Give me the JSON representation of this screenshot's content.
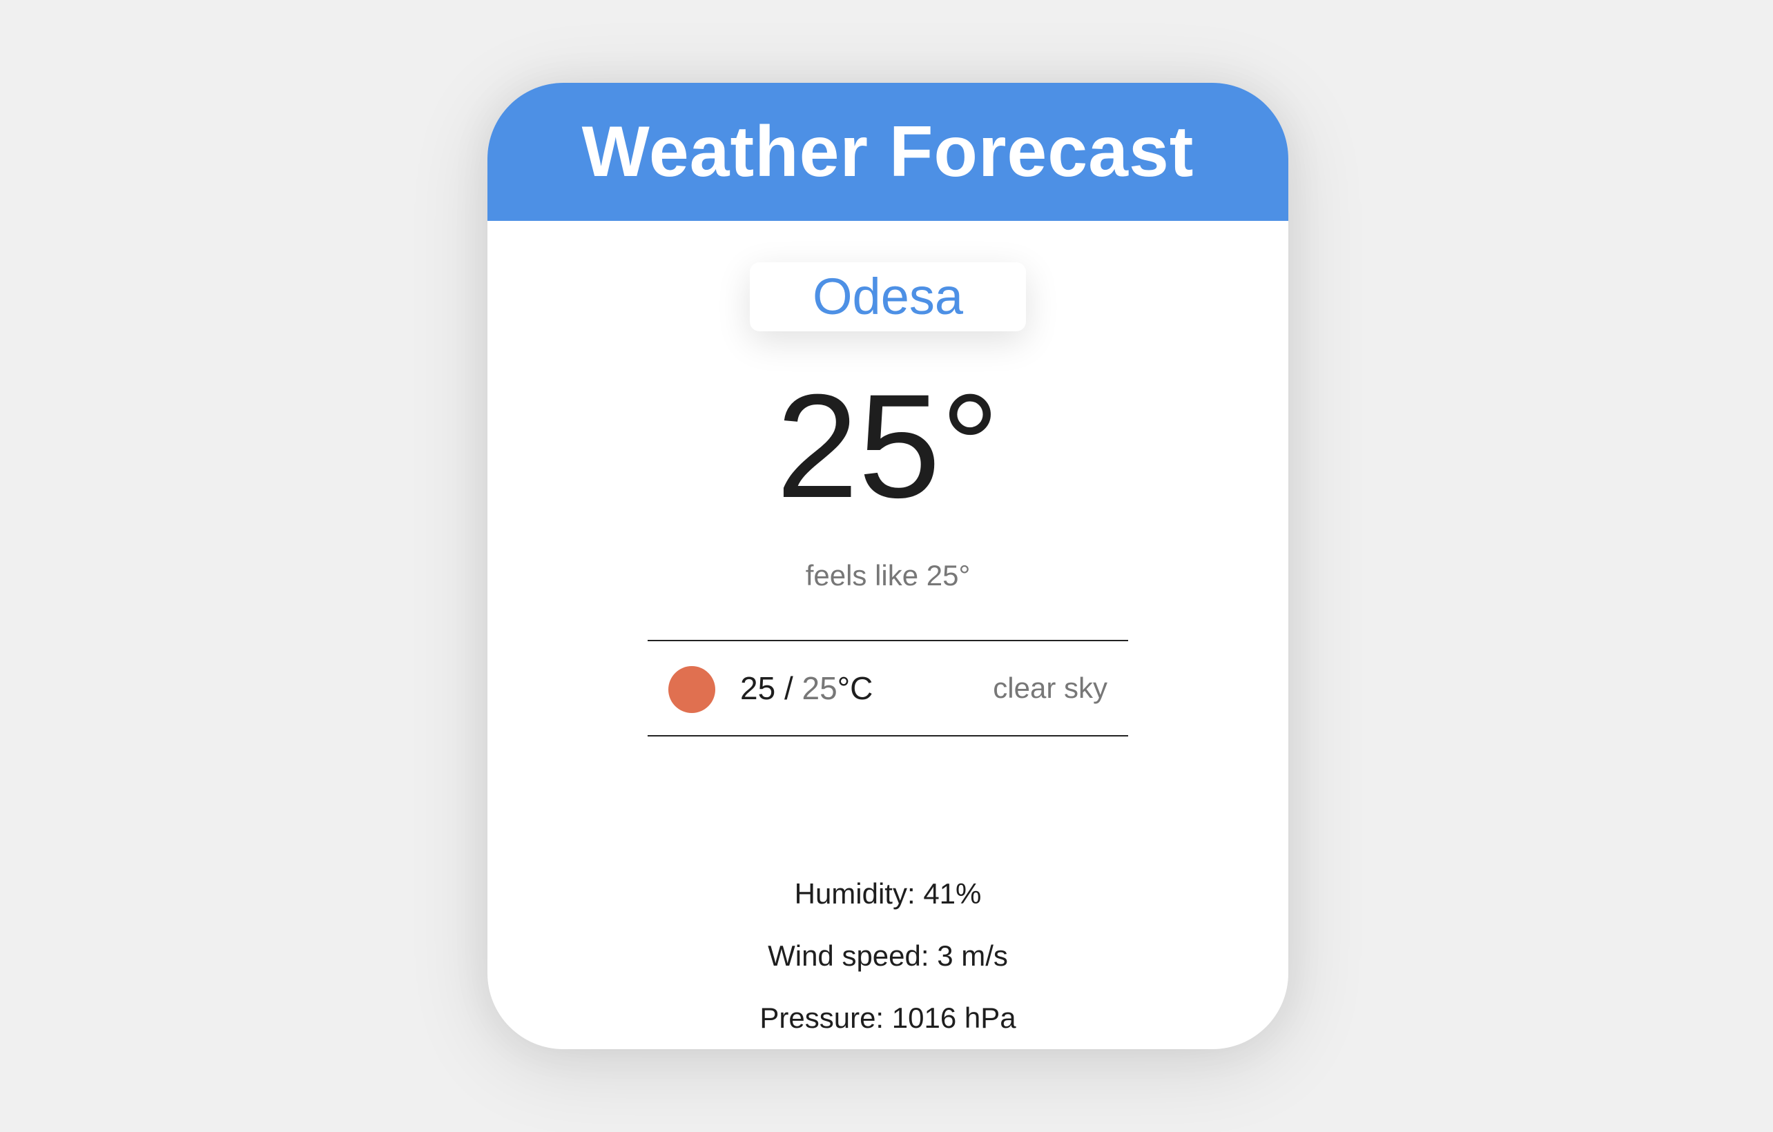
{
  "header": {
    "title": "Weather Forecast"
  },
  "city": {
    "name": "Odesa"
  },
  "current": {
    "temperature": "25°",
    "feels_like": "feels like 25°"
  },
  "summary": {
    "icon": "sun-icon",
    "icon_color": "#e07050",
    "max": "25",
    "separator": " / ",
    "min": "25",
    "unit": "°C",
    "description": "clear sky"
  },
  "details": {
    "humidity": "Humidity: 41%",
    "wind": "Wind speed: 3 m/s",
    "pressure": "Pressure: 1016 hPa"
  },
  "colors": {
    "accent": "#4d90e5",
    "background": "#f0f0f0",
    "card": "#ffffff",
    "muted_text": "#777777"
  }
}
